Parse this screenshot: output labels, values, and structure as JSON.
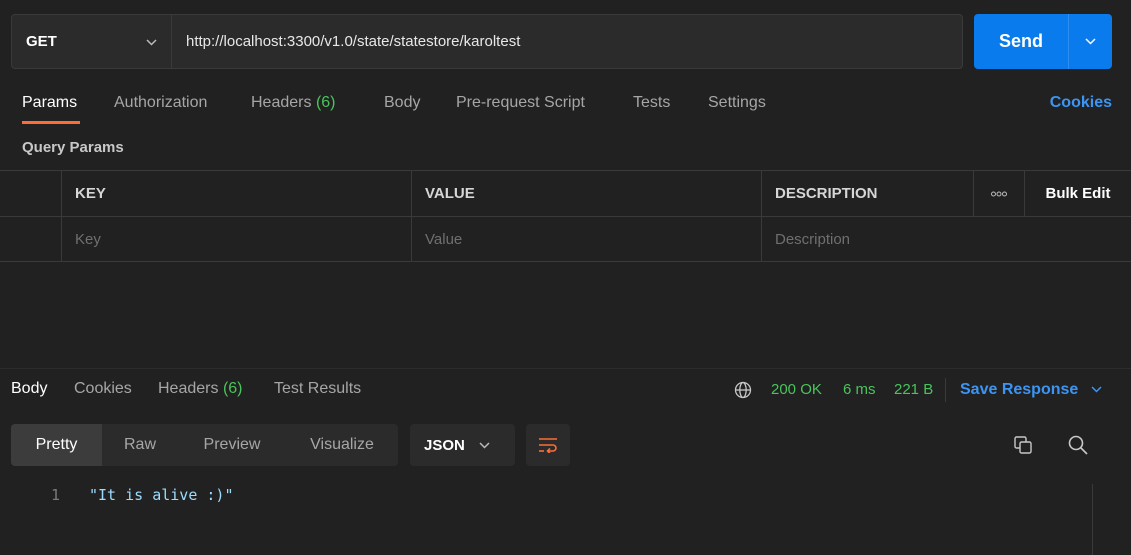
{
  "request": {
    "method": "GET",
    "url": "http://localhost:3300/v1.0/state/statestore/karoltest",
    "send_label": "Send"
  },
  "request_tabs": {
    "params": "Params",
    "authorization": "Authorization",
    "headers": "Headers",
    "headers_count": "(6)",
    "body": "Body",
    "pre_request": "Pre-request Script",
    "tests": "Tests",
    "settings": "Settings",
    "cookies": "Cookies"
  },
  "query_params": {
    "title": "Query Params",
    "columns": {
      "key": "KEY",
      "value": "VALUE",
      "description": "DESCRIPTION",
      "more_icon": "more-horizontal-icon",
      "bulk_edit": "Bulk Edit"
    },
    "placeholders": {
      "key": "Key",
      "value": "Value",
      "description": "Description"
    }
  },
  "response": {
    "tabs": {
      "body": "Body",
      "cookies": "Cookies",
      "headers": "Headers",
      "headers_count": "(6)",
      "test_results": "Test Results"
    },
    "status": "200 OK",
    "time": "6 ms",
    "size": "221 B",
    "save_label": "Save Response",
    "view_modes": [
      "Pretty",
      "Raw",
      "Preview",
      "Visualize"
    ],
    "selected_view": "Pretty",
    "language": "JSON",
    "code_lines": [
      {
        "number": "1",
        "text": "\"It is alive :)\""
      }
    ]
  },
  "colors": {
    "accent_orange": "#ff6c37",
    "send_blue": "#097bed",
    "link_blue": "#3b95f4",
    "status_green": "#49c45b",
    "background": "#212121"
  }
}
